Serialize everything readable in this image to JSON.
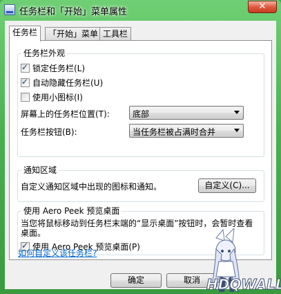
{
  "window": {
    "title": "任务栏和「开始」菜单属性",
    "close_label": "✕"
  },
  "tabs": [
    {
      "label": "任务栏",
      "active": true
    },
    {
      "label": "「开始」菜单",
      "active": false
    },
    {
      "label": "工具栏",
      "active": false
    }
  ],
  "appearance": {
    "title": "任务栏外观",
    "lock_taskbar": {
      "label": "锁定任务栏(L)",
      "checked": true
    },
    "auto_hide": {
      "label": "自动隐藏任务栏(U)",
      "checked": true
    },
    "small_icons": {
      "label": "使用小图标(I)",
      "checked": false
    },
    "position_label": "屏幕上的任务栏位置(T):",
    "position_value": "底部",
    "buttons_label": "任务栏按钮(B):",
    "buttons_value": "当任务栏被占满时合并"
  },
  "notification": {
    "title": "通知区域",
    "description": "自定义通知区域中出现的图标和通知。",
    "customize_button": "自定义(C)..."
  },
  "aero_peek": {
    "title": "使用 Aero Peek 预览桌面",
    "description": "当您将鼠标移动到任务栏末端的“显示桌面”按钮时，会暂时查看桌面。",
    "checkbox": {
      "label": "使用 Aero Peek 预览桌面(P)",
      "checked": true
    }
  },
  "help_link": "如何自定义该任务栏?",
  "buttons": {
    "ok": "确定",
    "cancel": "取消"
  },
  "watermark_text": "HDQWALL"
}
